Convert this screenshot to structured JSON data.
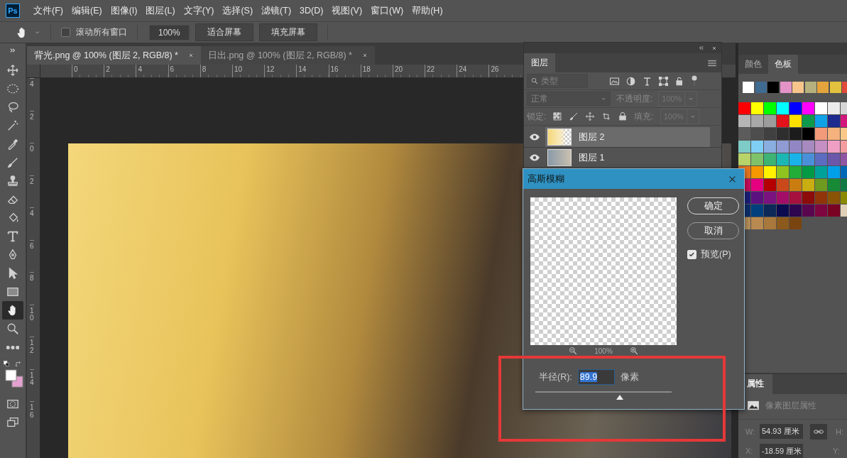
{
  "app_logo": "Ps",
  "menu": [
    "文件(F)",
    "编辑(E)",
    "图像(I)",
    "图层(L)",
    "文字(Y)",
    "选择(S)",
    "滤镜(T)",
    "3D(D)",
    "视图(V)",
    "窗口(W)",
    "帮助(H)"
  ],
  "options_bar": {
    "scroll_all": {
      "label": "滚动所有窗口",
      "checked": false
    },
    "zoom": "100%",
    "buttons": [
      "适合屏幕",
      "填充屏幕"
    ]
  },
  "tools": [
    {
      "kind": "move",
      "selected": false
    },
    {
      "kind": "marquee",
      "selected": false
    },
    {
      "kind": "lasso",
      "selected": false
    },
    {
      "kind": "wand",
      "selected": false
    },
    {
      "kind": "eyedropper",
      "selected": false
    },
    {
      "kind": "brush",
      "selected": false
    },
    {
      "kind": "stamp",
      "selected": false
    },
    {
      "kind": "eraser",
      "selected": false
    },
    {
      "kind": "bucket",
      "selected": false
    },
    {
      "kind": "type",
      "selected": false
    },
    {
      "kind": "pen",
      "selected": false
    },
    {
      "kind": "pointer",
      "selected": false
    },
    {
      "kind": "rectangle",
      "selected": false
    },
    {
      "kind": "hand",
      "selected": true
    },
    {
      "kind": "zoom",
      "selected": false
    },
    {
      "kind": "more",
      "selected": false
    }
  ],
  "documents": [
    {
      "title": "背光.png @ 100% (图层 2, RGB/8) *",
      "selected": true
    },
    {
      "title": "日出.png @ 100% (图层 2, RGB/8) *",
      "selected": false
    }
  ],
  "ruler": {
    "horizontal": [
      "0",
      "2",
      "4",
      "6",
      "8",
      "10",
      "12",
      "14",
      "16",
      "18",
      "20",
      "22",
      "24",
      "26"
    ],
    "vertical": [
      "4",
      "2",
      "0",
      "2",
      "4",
      "6",
      "8",
      "10",
      "12",
      "14",
      "16"
    ]
  },
  "layers_panel": {
    "title": "图层",
    "filter": "类型",
    "blend_mode": "正常",
    "opacity_label": "不透明度:",
    "opacity": "100%",
    "lock_label": "锁定:",
    "fill_label": "填充:",
    "fill": "100%",
    "layers": [
      {
        "name": "图层 2",
        "kind": "gradient",
        "visible": true,
        "selected": true
      },
      {
        "name": "图层 1",
        "kind": "photo",
        "visible": true,
        "selected": false
      }
    ]
  },
  "swatches_panel": {
    "tabs": [
      {
        "label": "颜色",
        "selected": false
      },
      {
        "label": "色板",
        "selected": true
      }
    ],
    "recent": [
      {
        "color": "#ffffff"
      },
      {
        "color": "#3f6b91"
      },
      {
        "color": "#000000"
      },
      {
        "color": "#e493c8"
      },
      {
        "color": "#f7c58c"
      },
      {
        "color": "#b5b07d"
      },
      {
        "color": "#e4a43c"
      },
      {
        "color": "#e2c13e"
      },
      {
        "color": "#e04b3b"
      }
    ],
    "rows": [
      {
        "swatches": [
          {
            "color": "#ff0000"
          },
          {
            "color": "#ffff00"
          },
          {
            "color": "#00ff00"
          },
          {
            "color": "#00ffff"
          },
          {
            "color": "#0000ff"
          },
          {
            "color": "#ff00ff"
          },
          {
            "color": "#ffffff"
          },
          {
            "color": "#ebebeb"
          },
          {
            "color": "#d6d6d6"
          }
        ]
      },
      {
        "swatches": [
          {
            "color": "#b5b5b5"
          },
          {
            "color": "#a8a8a8"
          },
          {
            "color": "#9c9c9c"
          },
          {
            "color": "#e3121b"
          },
          {
            "color": "#ffe000"
          },
          {
            "color": "#0e9a4a"
          },
          {
            "color": "#11a1e6"
          },
          {
            "color": "#1f2a8e"
          },
          {
            "color": "#d1177b"
          }
        ]
      },
      {
        "swatches": [
          {
            "color": "#5c5c5c"
          },
          {
            "color": "#4d4d4d"
          },
          {
            "color": "#404040"
          },
          {
            "color": "#2e2e2e"
          },
          {
            "color": "#1c1c1c"
          },
          {
            "color": "#000000"
          },
          {
            "color": "#f29a7a"
          },
          {
            "color": "#f6b27c"
          },
          {
            "color": "#fac98a"
          }
        ]
      },
      {
        "swatches": [
          {
            "color": "#7ecbc8"
          },
          {
            "color": "#7fcff4"
          },
          {
            "color": "#8aaee0"
          },
          {
            "color": "#8f9bd2"
          },
          {
            "color": "#9287c3"
          },
          {
            "color": "#a78ac0"
          },
          {
            "color": "#c48fc3"
          },
          {
            "color": "#f09fc4"
          },
          {
            "color": "#f39ca0"
          }
        ]
      },
      {
        "swatches": [
          {
            "color": "#b7d36a"
          },
          {
            "color": "#7fc26a"
          },
          {
            "color": "#3db374"
          },
          {
            "color": "#1db7b3"
          },
          {
            "color": "#19b3e9"
          },
          {
            "color": "#4a90d9"
          },
          {
            "color": "#5b6cc1"
          },
          {
            "color": "#6b58ab"
          },
          {
            "color": "#8f55a3"
          }
        ]
      },
      {
        "swatches": [
          {
            "color": "#e8761f"
          },
          {
            "color": "#f39800"
          },
          {
            "color": "#fff100"
          },
          {
            "color": "#8fc31f"
          },
          {
            "color": "#22ac38"
          },
          {
            "color": "#009944"
          },
          {
            "color": "#00a199"
          },
          {
            "color": "#00a0e9"
          },
          {
            "color": "#0068b7"
          }
        ]
      },
      {
        "swatches": [
          {
            "color": "#c80d5a"
          },
          {
            "color": "#e4007f"
          },
          {
            "color": "#b50000"
          },
          {
            "color": "#c9491a"
          },
          {
            "color": "#c97d10"
          },
          {
            "color": "#c8ae10"
          },
          {
            "color": "#6f9a20"
          },
          {
            "color": "#178a35"
          },
          {
            "color": "#0f7a44"
          }
        ]
      },
      {
        "swatches": [
          {
            "color": "#1c1f7a"
          },
          {
            "color": "#5b127f"
          },
          {
            "color": "#7a1280"
          },
          {
            "color": "#a30e68"
          },
          {
            "color": "#a5103e"
          },
          {
            "color": "#8c0b0b"
          },
          {
            "color": "#8f3509"
          },
          {
            "color": "#8a5406"
          },
          {
            "color": "#8a8a00"
          }
        ]
      },
      {
        "swatches": [
          {
            "color": "#0d2f6c"
          },
          {
            "color": "#003f7e"
          },
          {
            "color": "#0b2858"
          },
          {
            "color": "#0b0b50"
          },
          {
            "color": "#2d064f"
          },
          {
            "color": "#59064f"
          },
          {
            "color": "#7d0540"
          },
          {
            "color": "#7a0323"
          },
          {
            "color": "#e0d0b8"
          }
        ]
      },
      {
        "swatches": [
          {
            "color": "#b8905a"
          },
          {
            "color": "#b88a52"
          },
          {
            "color": "#a8783c"
          },
          {
            "color": "#8c5a1c"
          },
          {
            "color": "#7a4410"
          }
        ]
      }
    ]
  },
  "properties_panel": {
    "title": "属性",
    "subtitle": "像素图层属性",
    "rows": [
      {
        "kind": "size",
        "label": "W:",
        "value": "54.93 厘米",
        "side_label": "H:"
      },
      {
        "kind": "position",
        "label": "X:",
        "value": "-18.59 厘米",
        "side_label": "Y:"
      }
    ]
  },
  "dialog": {
    "title": "高斯模糊",
    "buttons": [
      "确定",
      "取消"
    ],
    "preview": {
      "label": "预览(P)",
      "checked": true
    },
    "zoom": "100%",
    "radius": {
      "label": "半径(R):",
      "value": "89.9",
      "unit": "像素",
      "level": 0.62
    }
  }
}
